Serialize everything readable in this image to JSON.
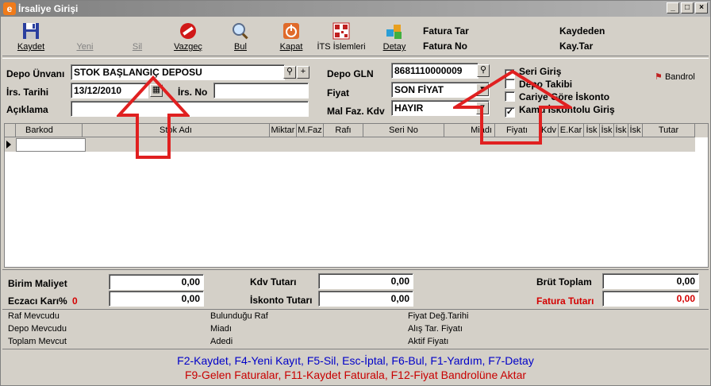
{
  "window": {
    "title": "İrsaliye Girişi",
    "minimize": "_",
    "maximize": "□",
    "close": "×"
  },
  "toolbar": {
    "kaydet": "Kaydet",
    "yeni": "Yeni",
    "sil": "Sil",
    "vazgec": "Vazgeç",
    "bul": "Bul",
    "kapat": "Kapat",
    "its": "İTS İslemleri",
    "detay": "Detay"
  },
  "header_info": {
    "fatura_tar": "Fatura Tar",
    "fatura_no": "Fatura No",
    "kaydeden": "Kaydeden",
    "kay_tar": "Kay.Tar"
  },
  "form": {
    "depo_unvani_label": "Depo Ünvanı",
    "depo_unvani_value": "STOK BAŞLANGIÇ DEPOSU",
    "irs_tarihi_label": "İrs. Tarihi",
    "irs_tarihi_value": "13/12/2010",
    "irs_no_label": "İrs. No",
    "irs_no_value": "",
    "aciklama_label": "Açıklama",
    "aciklama_value": "",
    "depo_gln_label": "Depo GLN",
    "depo_gln_value": "8681110000009",
    "fiyat_label": "Fiyat",
    "fiyat_value": "SON FİYAT",
    "mal_faz_label": "Mal Faz. Kdv",
    "mal_faz_value": "HAYIR",
    "seri_giris": "Seri Giriş",
    "depo_takibi": "Depo Takibi",
    "cariye_gore": "Cariye Göre İskonto",
    "kamu_iskonto": "Kamu İskontolu Giriş",
    "bandrol": "Bandrol",
    "plus": "+"
  },
  "checkboxes": {
    "seri_giris": true,
    "depo_takibi": false,
    "cariye_gore": false,
    "kamu_iskonto": true
  },
  "grid": {
    "columns": [
      "Barkod",
      "Stok Adı",
      "Miktar",
      "M.Faz",
      "Rafı",
      "Seri No",
      "Miadı",
      "Fiyatı",
      "Kdv",
      "E.Kar",
      "İsk",
      "İsk",
      "İsk",
      "İsk",
      "Tutar"
    ]
  },
  "totals": {
    "birim_maliyet_label": "Birim Maliyet",
    "birim_maliyet_value": "0,00",
    "eczaci_kari_label": "Eczacı Karı%",
    "eczaci_kari_count": "0",
    "eczaci_kari_value": "0,00",
    "kdv_tutari_label": "Kdv Tutarı",
    "kdv_tutari_value": "0,00",
    "iskonto_tutari_label": "İskonto Tutarı",
    "iskonto_tutari_value": "0,00",
    "brut_toplam_label": "Brüt Toplam",
    "brut_toplam_value": "0,00",
    "fatura_tutari_label": "Fatura Tutarı",
    "fatura_tutari_value": "0,00"
  },
  "info": {
    "raf_mevcudu": "Raf Mevcudu",
    "depo_mevcudu": "Depo Mevcudu",
    "toplam_mevcut": "Toplam Mevcut",
    "bulundugu_raf": "Bulunduğu Raf",
    "miadi": "Miadı",
    "adedi": "Adedi",
    "fiyat_deg_tarihi": "Fiyat Değ.Tarihi",
    "alis_tar_fiyati": "Alış Tar. Fiyatı",
    "aktif_fiyati": "Aktif Fiyatı"
  },
  "shortcuts": {
    "line1": "F2-Kaydet,  F4-Yeni Kayıt,  F5-Sil,  Esc-İptal,  F6-Bul,  F1-Yardım,  F7-Detay",
    "line2": "F9-Gelen Faturalar,  F11-Kaydet Faturala,  F12-Fiyat Bandrolüne Aktar"
  },
  "colors": {
    "accent_red": "#d40000",
    "shortcut_blue": "#0000c8",
    "arrow_red": "#e02020"
  }
}
